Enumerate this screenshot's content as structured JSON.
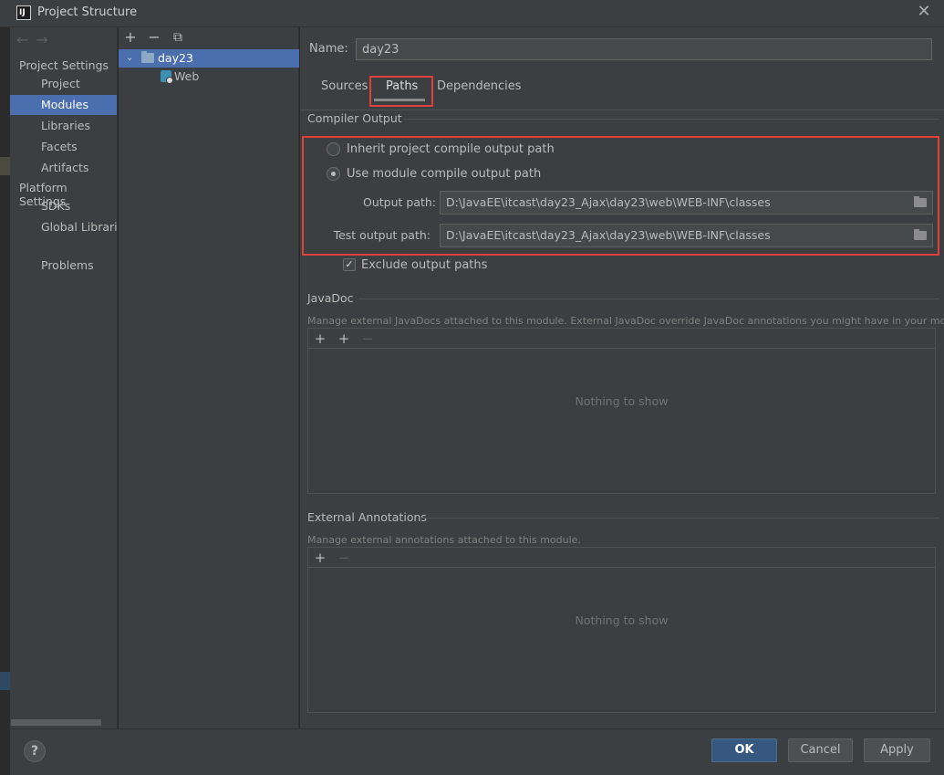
{
  "window": {
    "title": "Project Structure",
    "app_icon_text": "IJ",
    "close_glyph": "✕"
  },
  "sidebar": {
    "nav_back": "←",
    "nav_forward": "→",
    "project_settings_header": "Project Settings",
    "platform_settings_header": "Platform Settings",
    "items": {
      "project": "Project",
      "modules": "Modules",
      "libraries": "Libraries",
      "facets": "Facets",
      "artifacts": "Artifacts",
      "sdks": "SDKs",
      "global_libraries": "Global Libraries",
      "problems": "Problems"
    },
    "selected": "Modules"
  },
  "tree": {
    "toolbar": {
      "add": "+",
      "remove": "−",
      "copy": "⧉"
    },
    "module": "day23",
    "facet": "Web"
  },
  "main": {
    "name_label": "Name:",
    "name_value": "day23",
    "tabs": {
      "sources": "Sources",
      "paths": "Paths",
      "dependencies": "Dependencies"
    },
    "active_tab": "Paths",
    "compiler_output": {
      "title": "Compiler Output",
      "inherit_label": "Inherit project compile output path",
      "use_module_label": "Use module compile output path",
      "selected": "use_module",
      "output_path_label": "Output path:",
      "output_path_value": "D:\\JavaEE\\itcast\\day23_Ajax\\day23\\web\\WEB-INF\\classes",
      "test_output_path_label": "Test output path:",
      "test_output_path_value": "D:\\JavaEE\\itcast\\day23_Ajax\\day23\\web\\WEB-INF\\classes",
      "exclude_label": "Exclude output paths",
      "exclude_checked": true,
      "check_glyph": "✓"
    },
    "javadoc": {
      "title": "JavaDoc",
      "description": "Manage external JavaDocs attached to this module. External JavaDoc override JavaDoc annotations you might have in your module.",
      "toolbar": {
        "add": "+",
        "add_url": "+",
        "remove": "−"
      },
      "empty": "Nothing to show"
    },
    "external_annotations": {
      "title": "External Annotations",
      "description": "Manage external annotations attached to this module.",
      "toolbar": {
        "add": "+",
        "remove": "−"
      },
      "empty": "Nothing to show"
    }
  },
  "footer": {
    "help": "?",
    "ok": "OK",
    "cancel": "Cancel",
    "apply": "Apply"
  },
  "colors": {
    "accent_selection": "#4b6eaf",
    "highlight_frame": "#e0403b",
    "primary_button": "#365880"
  }
}
